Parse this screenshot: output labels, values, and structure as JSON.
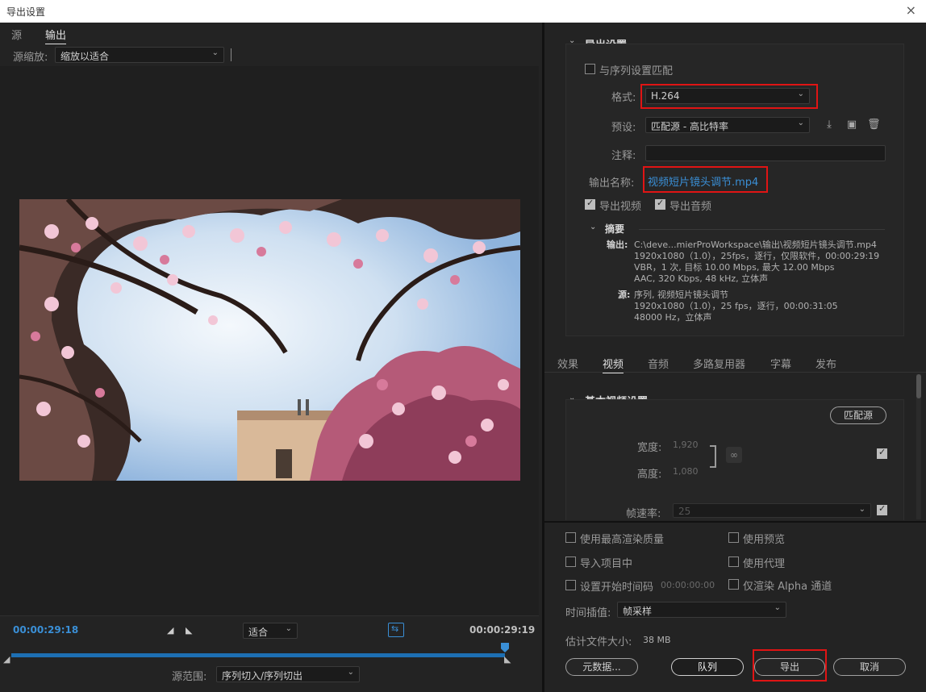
{
  "window": {
    "title": "导出设置",
    "close_glyph": "×"
  },
  "left": {
    "tabs": [
      "源",
      "输出"
    ],
    "zoom_label": "源缩放:",
    "zoom_value": "缩放以适合",
    "timecode_start": "00:00:29:18",
    "timecode_end": "00:00:29:19",
    "fit_value": "适合",
    "source_range_label": "源范围:",
    "source_range_value": "序列切入/序列切出"
  },
  "export": {
    "section_title": "导出设置",
    "match_sequence_label": "与序列设置匹配",
    "format_label": "格式:",
    "format_value": "H.264",
    "preset_label": "预设:",
    "preset_value": "匹配源 - 高比特率",
    "comment_label": "注释:",
    "comment_value": "",
    "output_name_label": "输出名称:",
    "output_name_value": "视频短片镜头调节.mp4",
    "export_video_label": "导出视频",
    "export_audio_label": "导出音频",
    "summary_title": "摘要",
    "summary_output_label": "输出:",
    "summary_output_lines": [
      "C:\\deve...mierProWorkspace\\输出\\视频短片镜头调节.mp4",
      "1920x1080（1.0），25fps，逐行，仅限软件，00:00:29:19",
      "VBR，1 次, 目标 10.00 Mbps, 最大 12.00 Mbps",
      "AAC, 320 Kbps, 48  kHz, 立体声"
    ],
    "summary_source_label": "源:",
    "summary_source_lines": [
      "序列, 视频短片镜头调节",
      "1920x1080（1.0），25 fps，逐行，00:00:31:05",
      "48000 Hz，立体声"
    ]
  },
  "right_tabs": [
    "效果",
    "视频",
    "音频",
    "多路复用器",
    "字幕",
    "发布"
  ],
  "video": {
    "section_title": "基本视频设置",
    "match_source_button": "匹配源",
    "width_label": "宽度:",
    "width_value": "1,920",
    "height_label": "高度:",
    "height_value": "1,080",
    "fps_label": "帧速率:",
    "fps_value": "25"
  },
  "bottom": {
    "max_render_quality": "使用最高渲染质量",
    "use_previews": "使用预览",
    "import_into_project": "导入项目中",
    "use_proxies": "使用代理",
    "set_start_timecode": "设置开始时间码",
    "start_timecode_value": "00:00:00:00",
    "render_alpha_only": "仅渲染 Alpha 通道",
    "time_interp_label": "时间插值:",
    "time_interp_value": "帧采样",
    "est_size_label": "估计文件大小:",
    "est_size_value": "38 MB",
    "metadata_button": "元数据...",
    "queue_button": "队列",
    "export_button": "导出",
    "cancel_button": "取消"
  },
  "colors": {
    "accent": "#3a8fd6",
    "highlight": "#e01414"
  },
  "icons": [
    "close-icon",
    "chevron-down-icon",
    "import-preset-icon",
    "save-preset-icon",
    "delete-preset-icon",
    "link-icon",
    "mark-in-icon",
    "mark-out-icon",
    "fit-frame-icon"
  ]
}
